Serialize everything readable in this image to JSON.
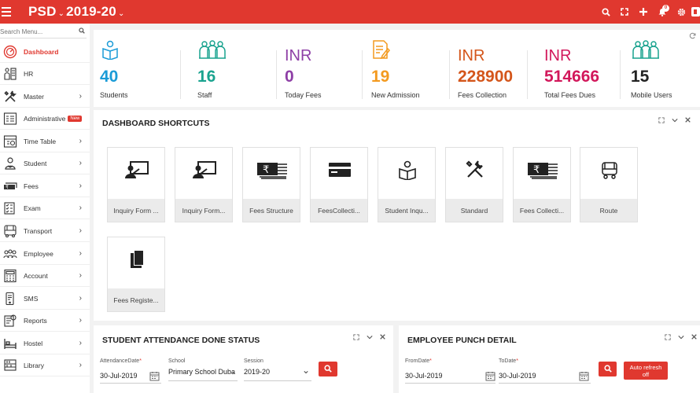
{
  "topbar": {
    "title": "PSD",
    "year": "2019-20",
    "chevron": "⌄",
    "notif_count": "0",
    "icons": [
      "search-icon",
      "fullscreen-icon",
      "plus-icon",
      "bell-icon",
      "gear-icon",
      "user-icon"
    ]
  },
  "sidebar": {
    "search_placeholder": "Search Menu...",
    "items": [
      {
        "label": "Dashboard",
        "icon": "dashboard-icon",
        "active": true
      },
      {
        "label": "HR",
        "icon": "hr-icon"
      },
      {
        "label": "Master",
        "icon": "tools-icon"
      },
      {
        "label": "Administrative",
        "icon": "admin-icon",
        "badge": "New"
      },
      {
        "label": "Time Table",
        "icon": "timetable-icon"
      },
      {
        "label": "Student",
        "icon": "student-icon"
      },
      {
        "label": "Fees",
        "icon": "fees-icon"
      },
      {
        "label": "Exam",
        "icon": "exam-icon"
      },
      {
        "label": "Transport",
        "icon": "bus-icon"
      },
      {
        "label": "Employee",
        "icon": "employee-icon"
      },
      {
        "label": "Account",
        "icon": "calculator-icon"
      },
      {
        "label": "SMS",
        "icon": "sms-icon"
      },
      {
        "label": "Reports",
        "icon": "reports-icon"
      },
      {
        "label": "Hostel",
        "icon": "bed-icon"
      },
      {
        "label": "Library",
        "icon": "library-icon"
      }
    ]
  },
  "stats": [
    {
      "currency": "",
      "value": "40",
      "label": "Students",
      "color": "#1a9bd7",
      "icon": "reader-icon"
    },
    {
      "currency": "",
      "value": "16",
      "label": "Staff",
      "color": "#1aa38f",
      "icon": "staff-icon"
    },
    {
      "currency": "INR",
      "value": "0",
      "label": "Today Fees",
      "color": "#8e3fa6"
    },
    {
      "currency": "",
      "value": "19",
      "label": "New Admission",
      "color": "#f39a1f",
      "icon": "form-icon"
    },
    {
      "currency": "INR",
      "value": "228900",
      "label": "Fees Collection",
      "color": "#d4561b"
    },
    {
      "currency": "INR",
      "value": "514666",
      "label": "Total Fees Dues",
      "color": "#d2185b"
    },
    {
      "currency": "",
      "value": "15",
      "label": "Mobile Users",
      "color": "#222222",
      "icon": "mobile-users-icon"
    }
  ],
  "shortcuts": {
    "title": "DASHBOARD SHORTCUTS",
    "tiles": [
      {
        "label": "Inquiry Form ...",
        "icon": "presenter-icon"
      },
      {
        "label": "Inquiry Form...",
        "icon": "presenter-icon"
      },
      {
        "label": "Fees Structure",
        "icon": "money-stack-icon"
      },
      {
        "label": "FeesCollecti...",
        "icon": "card-icon"
      },
      {
        "label": "Student Inqu...",
        "icon": "reader-icon"
      },
      {
        "label": "Standard",
        "icon": "tools-icon"
      },
      {
        "label": "Fees Collecti...",
        "icon": "money-stack-icon"
      },
      {
        "label": "Route",
        "icon": "bus-icon"
      },
      {
        "label": "Fees Registe...",
        "icon": "copy-icon"
      }
    ]
  },
  "attendance": {
    "title": "STUDENT ATTENDANCE DONE STATUS",
    "date_label": "AttendanceDate",
    "date_value": "30-Jul-2019",
    "school_label": "School",
    "school_value": "Primary School Duba",
    "session_label": "Session",
    "session_value": "2019-20"
  },
  "punch": {
    "title": "EMPLOYEE PUNCH DETAIL",
    "from_label": "FromDate",
    "from_value": "30-Jul-2019",
    "to_label": "ToDate",
    "to_value": "30-Jul-2019",
    "auto_refresh": "Auto refresh off"
  },
  "colors": {
    "accent": "#e0382f"
  }
}
